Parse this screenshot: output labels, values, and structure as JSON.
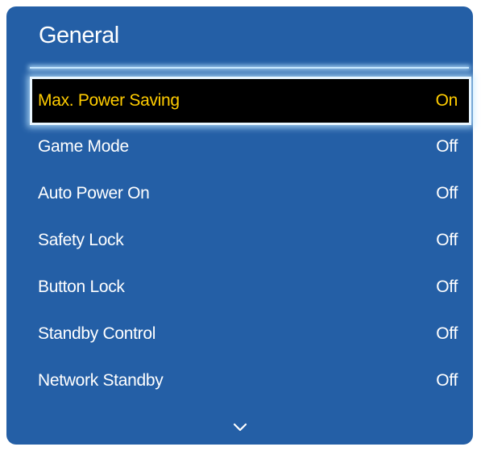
{
  "menu": {
    "title": "General",
    "items": [
      {
        "label": "Max. Power Saving",
        "value": "On"
      },
      {
        "label": "Game Mode",
        "value": "Off"
      },
      {
        "label": "Auto Power On",
        "value": "Off"
      },
      {
        "label": "Safety Lock",
        "value": "Off"
      },
      {
        "label": "Button Lock",
        "value": "Off"
      },
      {
        "label": "Standby Control",
        "value": "Off"
      },
      {
        "label": "Network Standby",
        "value": "Off"
      }
    ],
    "selected_index": 0
  },
  "colors": {
    "panel_background": "#245fa6",
    "selected_background": "#000000",
    "selected_text": "#ffcc00",
    "text": "#ffffff",
    "highlight_glow": "#c8e8ff"
  },
  "icons": {
    "scroll_down": "chevron-down-icon"
  }
}
